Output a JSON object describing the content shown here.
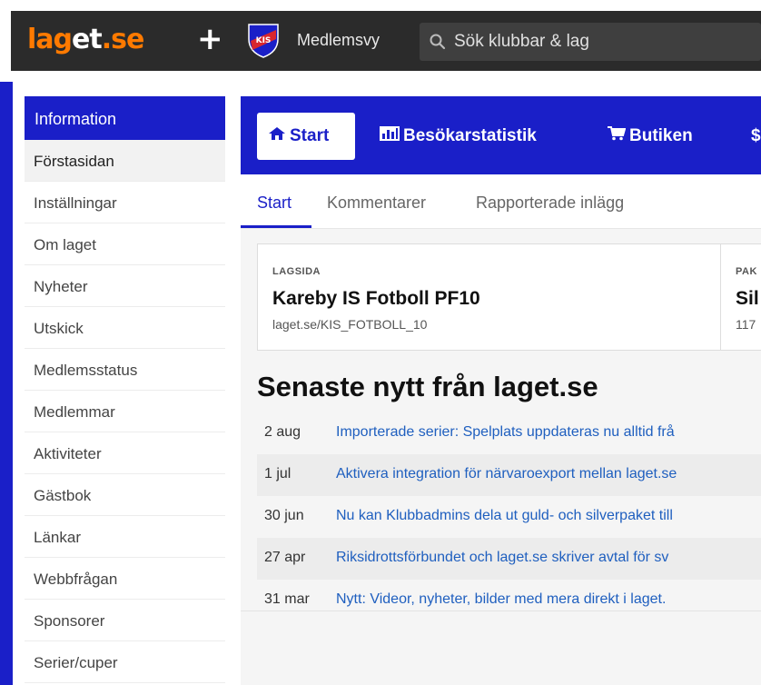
{
  "header": {
    "logo_lag": "lag",
    "logo_et": "et",
    "logo_se": ".se",
    "plus_symbol": "+",
    "club_view_label": "Medlemsvy",
    "search_placeholder": "Sök klubbar & lag",
    "crest_text": "KIS"
  },
  "sidebar": {
    "header": "Information",
    "items": [
      {
        "label": "Förstasidan",
        "active": true
      },
      {
        "label": "Inställningar"
      },
      {
        "label": "Om laget"
      },
      {
        "label": "Nyheter"
      },
      {
        "label": "Utskick"
      },
      {
        "label": "Medlemsstatus"
      },
      {
        "label": "Medlemmar"
      },
      {
        "label": "Aktiviteter"
      },
      {
        "label": "Gästbok"
      },
      {
        "label": "Länkar"
      },
      {
        "label": "Webbfrågan"
      },
      {
        "label": "Sponsorer"
      },
      {
        "label": "Serier/cuper"
      }
    ]
  },
  "nav": {
    "start": "Start",
    "stats": "Besökarstatistik",
    "shop": "Butiken",
    "more": "$"
  },
  "subtabs": {
    "start": "Start",
    "comments": "Kommentarer",
    "reported": "Rapporterade inlägg"
  },
  "card": {
    "left_label": "LAGSIDA",
    "left_title": "Kareby IS Fotboll PF10",
    "left_sub": "laget.se/KIS_FOTBOLL_10",
    "right_label": "PAK",
    "right_title": "Sil",
    "right_sub": "117"
  },
  "news": {
    "heading": "Senaste nytt från laget.se",
    "items": [
      {
        "date": "2 aug",
        "text": "Importerade serier: Spelplats uppdateras nu alltid frå"
      },
      {
        "date": "1 jul",
        "text": "Aktivera integration för närvaroexport mellan laget.se"
      },
      {
        "date": "30 jun",
        "text": "Nu kan Klubbadmins dela ut guld- och silverpaket till"
      },
      {
        "date": "27 apr",
        "text": "Riksidrottsförbundet och laget.se skriver avtal för sv"
      },
      {
        "date": "31 mar",
        "text": "Nytt: Videor, nyheter, bilder med mera direkt i laget."
      }
    ]
  },
  "colors": {
    "brand_orange": "#ff7a00",
    "primary_blue": "#1a1fc8",
    "topbar_dark": "#2b2b2b",
    "link_blue": "#1f5fbf"
  }
}
